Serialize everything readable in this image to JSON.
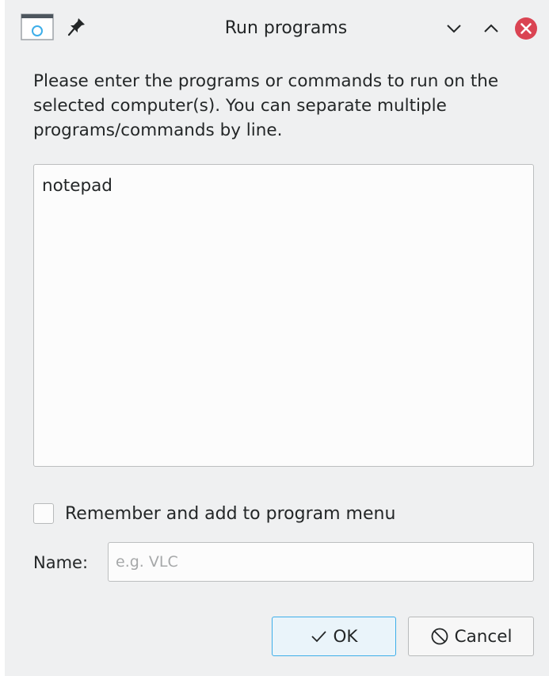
{
  "window": {
    "title": "Run programs",
    "icons": {
      "app": "window-app-icon",
      "pin": "pin-icon",
      "minimize": "chevron-down-icon",
      "maximize": "chevron-up-icon",
      "close": "close-icon"
    },
    "colors": {
      "background": "#eff0f1",
      "close_button": "#da4453",
      "accent": "#3daee9"
    }
  },
  "dialog": {
    "description": "Please enter the programs or commands to run on the selected computer(s). You can separate multiple programs/commands by line.",
    "commands_value": "notepad",
    "remember": {
      "label": "Remember and add to program menu",
      "checked": false
    },
    "name": {
      "label": "Name:",
      "value": "",
      "placeholder": "e.g. VLC"
    },
    "buttons": {
      "ok_label": "OK",
      "cancel_label": "Cancel"
    }
  }
}
